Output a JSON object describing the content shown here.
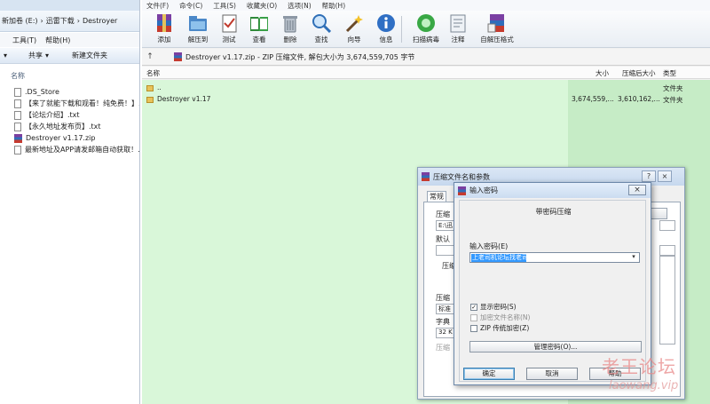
{
  "explorer": {
    "breadcrumb": [
      "新加卷 (E:)",
      "迅雷下载",
      "Destroyer"
    ],
    "menu": [
      "工具(T)",
      "帮助(H)"
    ],
    "toolbar": [
      "共享",
      "新建文件夹"
    ],
    "column_name": "名称",
    "files": [
      {
        "name": ".DS_Store",
        "icon": "document-icon"
      },
      {
        "name": "【来了就能下载和观看！纯免费！】...",
        "icon": "document-icon"
      },
      {
        "name": "【论坛介绍】.txt",
        "icon": "document-icon"
      },
      {
        "name": "【永久地址发布页】.txt",
        "icon": "document-icon"
      },
      {
        "name": "Destroyer v1.17.zip",
        "icon": "rar-archive-icon"
      },
      {
        "name": "最新地址及APP请发邮箱自动获取！...",
        "icon": "document-icon"
      }
    ]
  },
  "winrar": {
    "menu": [
      "文件(F)",
      "命令(C)",
      "工具(S)",
      "收藏夹(O)",
      "选项(N)",
      "帮助(H)"
    ],
    "toolbar": [
      {
        "label": "添加",
        "icon": "add-archive-icon"
      },
      {
        "label": "解压到",
        "icon": "extract-to-icon"
      },
      {
        "label": "测试",
        "icon": "test-icon"
      },
      {
        "label": "查看",
        "icon": "view-icon"
      },
      {
        "label": "删除",
        "icon": "delete-icon"
      },
      {
        "label": "查找",
        "icon": "find-icon"
      },
      {
        "label": "向导",
        "icon": "wizard-icon"
      },
      {
        "label": "信息",
        "icon": "info-icon"
      },
      {
        "label": "扫描病毒",
        "icon": "virus-scan-icon"
      },
      {
        "label": "注释",
        "icon": "comment-icon"
      },
      {
        "label": "自解压格式",
        "icon": "sfx-icon"
      }
    ],
    "path_text": "Destroyer v1.17.zip - ZIP 压缩文件, 解包大小为 3,674,559,705 字节",
    "columns": {
      "name": "名称",
      "size": "大小",
      "packed": "压缩后大小",
      "type": "类型"
    },
    "rows": [
      {
        "name": "..",
        "size": "",
        "packed": "",
        "type": "文件夹"
      },
      {
        "name": "Destroyer v1.17",
        "size": "3,674,559,...",
        "packed": "3,610,162,...",
        "type": "文件夹"
      }
    ],
    "colors": {
      "list_bg": "#d9f7d9",
      "list_bg_sorted": "#c6ecc6"
    }
  },
  "params_dialog": {
    "title": "压缩文件名和参数",
    "help_btn": "?",
    "close_btn": "×",
    "tab": "常规",
    "labels": [
      "压缩",
      "E:\\迅",
      "默认",
      "压缩",
      "压缩",
      "标准",
      "字典",
      "32 K",
      "压缩"
    ]
  },
  "password_dialog": {
    "title": "输入密码",
    "close_btn": "×",
    "heading": "带密码压缩",
    "input_label": "输入密码(E)",
    "input_value": "上老司机论坛找老司机",
    "checkboxes": [
      {
        "label": "显示密码(S)",
        "checked": true,
        "enabled": true
      },
      {
        "label": "加密文件名称(N)",
        "checked": false,
        "enabled": false
      },
      {
        "label": "ZIP 传统加密(Z)",
        "checked": false,
        "enabled": true
      }
    ],
    "manage_btn": "管理密码(O)...",
    "ok_btn": "确定",
    "cancel_btn": "取消",
    "help_btn": "帮助"
  },
  "watermark": {
    "cn": "老王论坛",
    "en": "laowang.vip"
  }
}
